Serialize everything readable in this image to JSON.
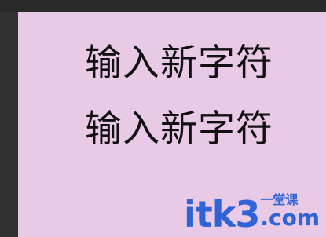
{
  "canvas": {
    "lines": [
      "输入新字符",
      "输入新字符"
    ],
    "background_color": "#e8c9e6",
    "text_color": "#111111"
  },
  "watermark": {
    "main": "itk3",
    "dot_com": ".com",
    "cn": "一堂课",
    "color": "#2f63d6"
  }
}
